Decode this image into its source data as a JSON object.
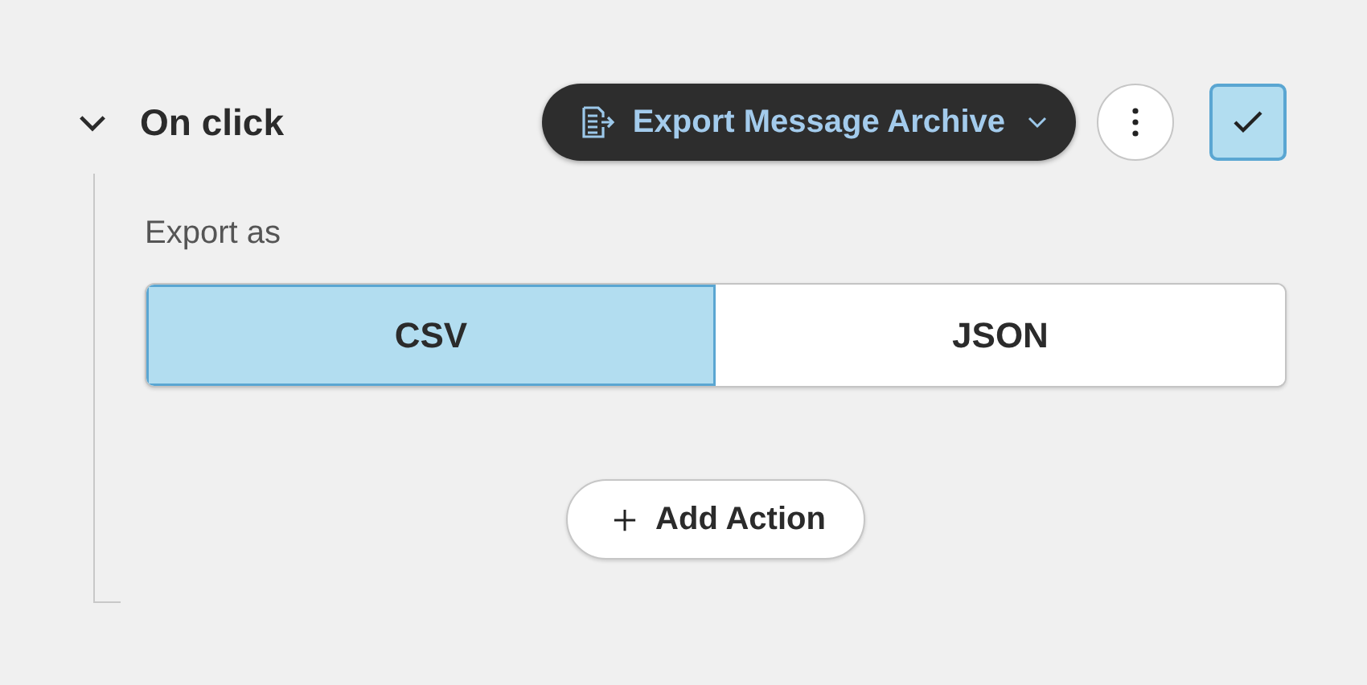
{
  "section": {
    "title": "On click",
    "expanded": true
  },
  "action": {
    "label": "Export Message Archive"
  },
  "confirm": {
    "checked": true
  },
  "field": {
    "label": "Export as"
  },
  "options": [
    {
      "label": "CSV",
      "selected": true
    },
    {
      "label": "JSON",
      "selected": false
    }
  ],
  "add_button": {
    "label": "Add Action"
  }
}
